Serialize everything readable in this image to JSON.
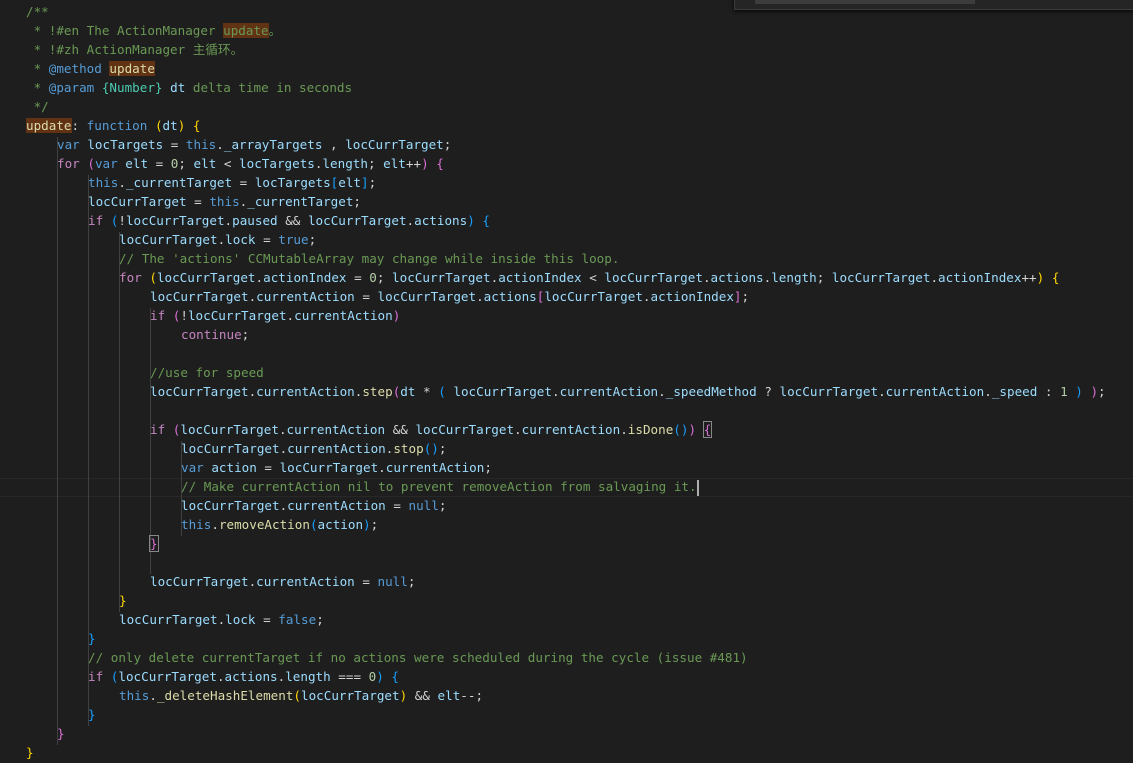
{
  "editor": {
    "language": "javascript",
    "colors": {
      "background": "#1e1e1e",
      "comment": "#6a9955",
      "keyword": "#569cd6",
      "control": "#c586c0",
      "variable": "#9cdcfe",
      "function": "#dcdcaa",
      "number": "#b5cea8",
      "type": "#4ec9b0",
      "find_highlight": "#613214"
    },
    "cursor_line": 26,
    "code_lines": [
      "/**",
      " * !#en The ActionManager update。",
      " * !#zh ActionManager 主循环。",
      " * @method update",
      " * @param {Number} dt delta time in seconds",
      " */",
      "update: function (dt) {",
      "    var locTargets = this._arrayTargets , locCurrTarget;",
      "    for (var elt = 0; elt < locTargets.length; elt++) {",
      "        this._currentTarget = locTargets[elt];",
      "        locCurrTarget = this._currentTarget;",
      "        if (!locCurrTarget.paused && locCurrTarget.actions) {",
      "            locCurrTarget.lock = true;",
      "            // The 'actions' CCMutableArray may change while inside this loop.",
      "            for (locCurrTarget.actionIndex = 0; locCurrTarget.actionIndex < locCurrTarget.actions.length; locCurrTarget.actionIndex++) {",
      "                locCurrTarget.currentAction = locCurrTarget.actions[locCurrTarget.actionIndex];",
      "                if (!locCurrTarget.currentAction)",
      "                    continue;",
      "",
      "                //use for speed",
      "                locCurrTarget.currentAction.step(dt * ( locCurrTarget.currentAction._speedMethod ? locCurrTarget.currentAction._speed : 1 ) );",
      "",
      "                if (locCurrTarget.currentAction && locCurrTarget.currentAction.isDone()) {",
      "                    locCurrTarget.currentAction.stop();",
      "                    var action = locCurrTarget.currentAction;",
      "                    // Make currentAction nil to prevent removeAction from salvaging it.",
      "                    locCurrTarget.currentAction = null;",
      "                    this.removeAction(action);",
      "                }",
      "",
      "                locCurrTarget.currentAction = null;",
      "            }",
      "            locCurrTarget.lock = false;",
      "        }",
      "        // only delete currentTarget if no actions were scheduled during the cycle (issue #481)",
      "        if (locCurrTarget.actions.length === 0) {",
      "            this._deleteHashElement(locCurrTarget) && elt--;",
      "        }",
      "    }",
      "}"
    ]
  }
}
